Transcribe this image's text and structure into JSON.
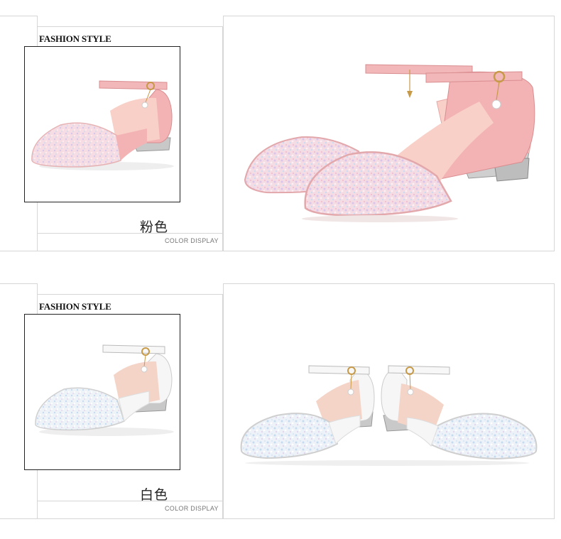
{
  "sections": [
    {
      "heading": "FASHION STYLE",
      "color_name": "粉色",
      "caption": "COLOR DISPLAY",
      "shoe_color": "pink",
      "strap_color": "#f2b7b8",
      "glitter_color": "#f6dfe6"
    },
    {
      "heading": "FASHION STYLE",
      "color_name": "白色",
      "caption": "COLOR DISPLAY",
      "shoe_color": "white",
      "strap_color": "#f4f4f4",
      "glitter_color": "#eaf1f8"
    }
  ]
}
